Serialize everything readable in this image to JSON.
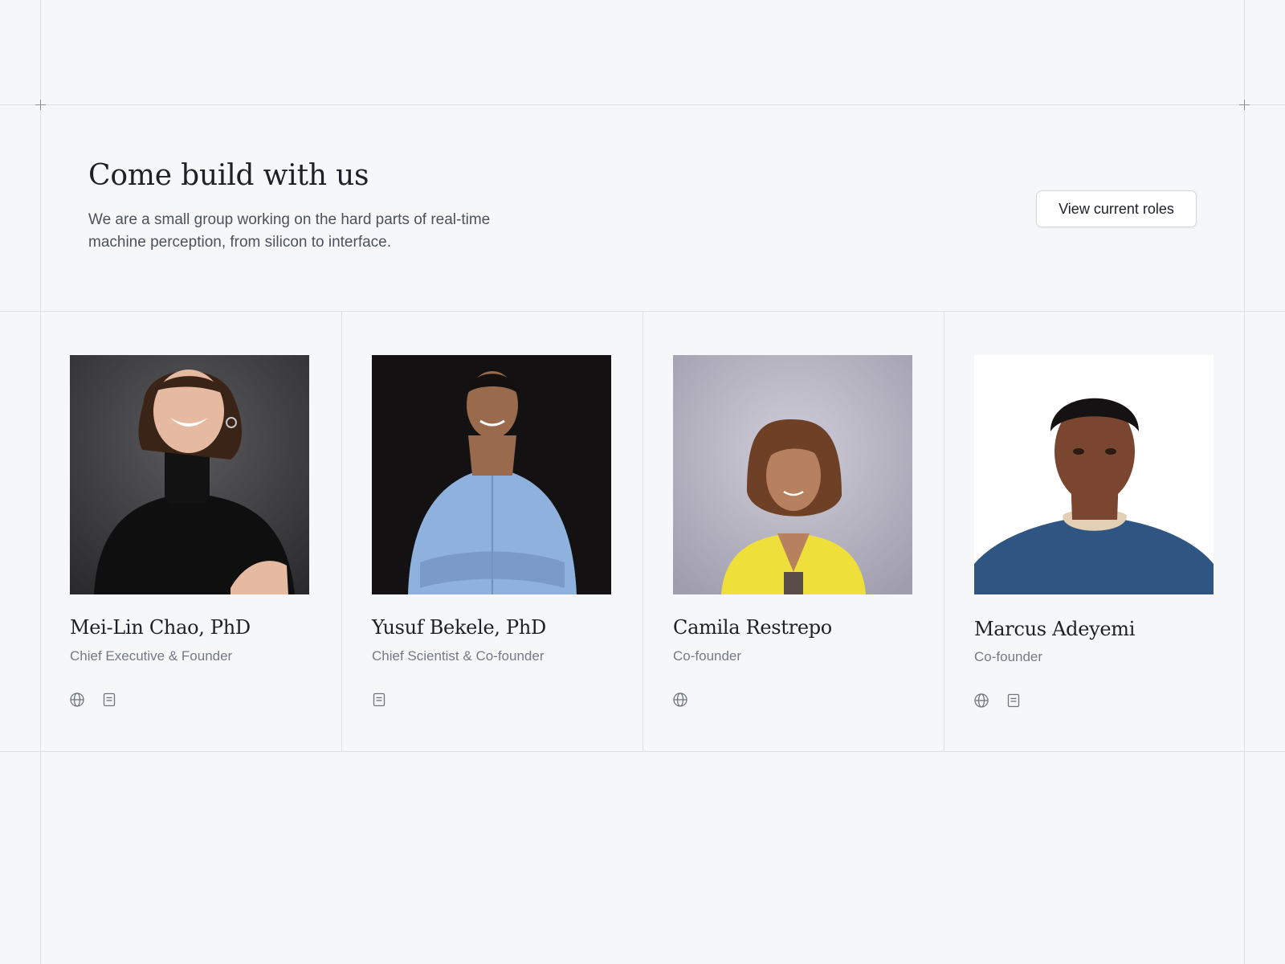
{
  "hero": {
    "title": "Come build with us",
    "subtitle": "We are a small group working on the hard parts of real-time machine perception, from silicon to interface.",
    "cta_label": "View current roles"
  },
  "team": [
    {
      "name": "Mei-Lin Chao, PhD",
      "role": "Chief Executive & Founder",
      "links": [
        "globe-icon",
        "document-icon"
      ],
      "photo_colors": {
        "background": "#3a3a3c",
        "clothing": "#0f0f10",
        "skin": "#e6b9a1",
        "hair": "#3a2418"
      }
    },
    {
      "name": "Yusuf Bekele, PhD",
      "role": "Chief Scientist & Co-founder",
      "links": [
        "document-icon"
      ],
      "photo_colors": {
        "background": "#141112",
        "clothing": "#8fb1de",
        "skin": "#9a6a4c",
        "hair": "#141010"
      }
    },
    {
      "name": "Camila Restrepo",
      "role": "Co-founder",
      "links": [
        "globe-icon"
      ],
      "photo_colors": {
        "background": "#acaab8",
        "clothing": "#efdf3b",
        "skin": "#b7805f",
        "hair": "#6e4127"
      }
    },
    {
      "name": "Marcus Adeyemi",
      "role": "Co-founder",
      "links": [
        "globe-icon",
        "document-icon"
      ],
      "photo_colors": {
        "background": "#ffffff",
        "clothing": "#2f5582",
        "skin": "#7a4630",
        "hair": "#141212"
      }
    }
  ],
  "colors": {
    "page_background": "#f5f7f9",
    "grid_line": "#dde1e6",
    "text_primary": "#1d2026",
    "text_secondary": "#747b85"
  }
}
